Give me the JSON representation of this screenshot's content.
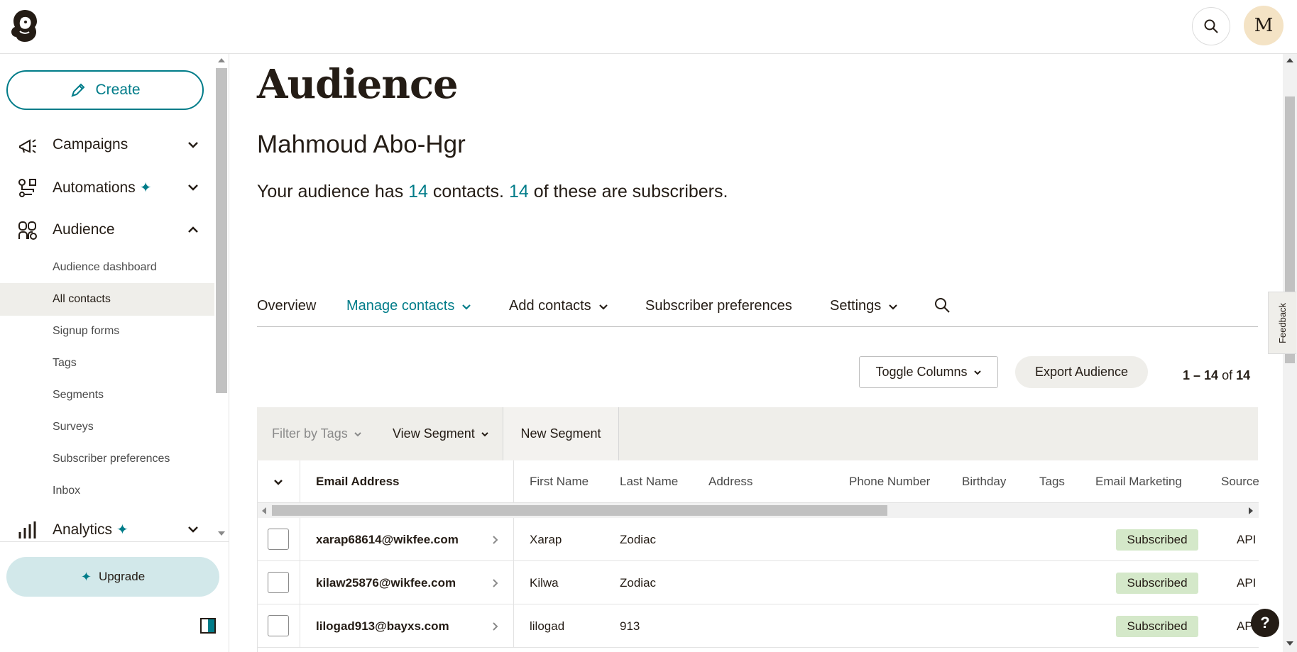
{
  "header": {
    "logo_icon": "mailchimp-freddie-icon",
    "search_icon": "search-icon",
    "avatar_initial": "M"
  },
  "sidebar": {
    "create_label": "Create",
    "nav": [
      {
        "label": "Campaigns",
        "icon": "megaphone-icon",
        "expanded": false
      },
      {
        "label": "Automations",
        "icon": "automation-flow-icon",
        "expanded": false,
        "sparkle": true
      },
      {
        "label": "Audience",
        "icon": "audience-icon",
        "expanded": true
      }
    ],
    "audience_items": [
      {
        "label": "Audience dashboard"
      },
      {
        "label": "All contacts",
        "active": true
      },
      {
        "label": "Signup forms"
      },
      {
        "label": "Tags"
      },
      {
        "label": "Segments"
      },
      {
        "label": "Surveys"
      },
      {
        "label": "Subscriber preferences"
      },
      {
        "label": "Inbox"
      }
    ],
    "analytics_label": "Analytics",
    "upgrade_label": "Upgrade"
  },
  "main": {
    "title": "Audience",
    "audience_name": "Mahmoud Abo-Hgr",
    "summary": {
      "prefix": "Your audience has",
      "contacts": "14",
      "middle": "contacts.",
      "subscribers": "14",
      "suffix": "of these are subscribers."
    },
    "tabs": [
      {
        "label": "Overview"
      },
      {
        "label": "Manage contacts",
        "active": true,
        "dropdown": true
      },
      {
        "label": "Add contacts",
        "dropdown": true
      },
      {
        "label": "Subscriber preferences"
      },
      {
        "label": "Settings",
        "dropdown": true
      }
    ],
    "toggle_columns_label": "Toggle Columns",
    "export_label": "Export Audience",
    "pager": {
      "range": "1 – 14",
      "of": "of",
      "total": "14"
    },
    "filters": {
      "tags_label": "Filter by Tags",
      "segment_label": "View Segment",
      "new_segment_label": "New Segment"
    },
    "columns": [
      "Email Address",
      "First Name",
      "Last Name",
      "Address",
      "Phone Number",
      "Birthday",
      "Tags",
      "Email Marketing",
      "Source"
    ],
    "rows": [
      {
        "email": "xarap68614@wikfee.com",
        "first": "Xarap",
        "last": "Zodiac",
        "status": "Subscribed",
        "source": "API"
      },
      {
        "email": "kilaw25876@wikfee.com",
        "first": "Kilwa",
        "last": "Zodiac",
        "status": "Subscribed",
        "source": "API"
      },
      {
        "email": "lilogad913@bayxs.com",
        "first": "lilogad",
        "last": "913",
        "status": "Subscribed",
        "source": "API"
      }
    ]
  },
  "feedback_label": "Feedback",
  "help_label": "?",
  "colors": {
    "accent": "#007c89",
    "subscribed_bg": "#d4e8c9",
    "panel_bg": "#efeeea"
  }
}
